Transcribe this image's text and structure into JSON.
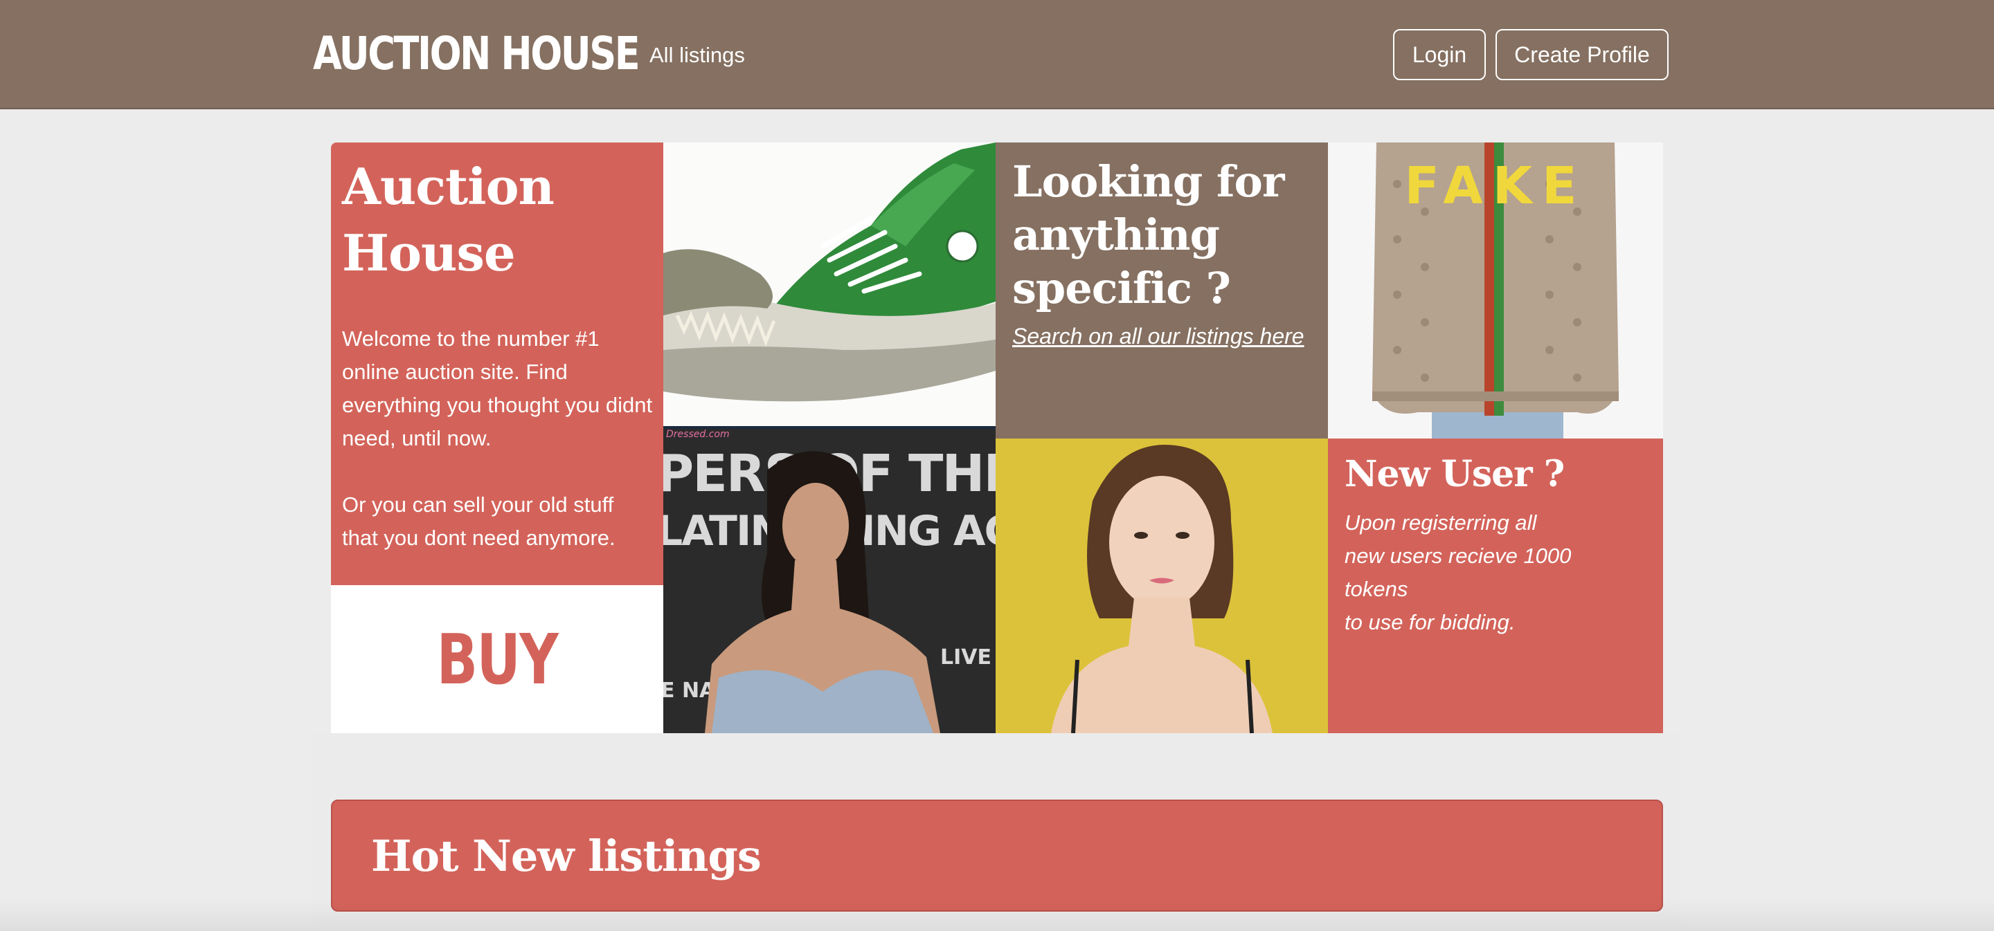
{
  "navbar": {
    "brand": "AUCTION HOUSE",
    "all_listings": "All listings",
    "login": "Login",
    "create_profile": "Create Profile",
    "bg_color": "#857061"
  },
  "hero": {
    "intro": {
      "title": "Auction House",
      "paragraph1": "Welcome to the number #1 online auction site. Find everything you thought you didnt need, until now.",
      "paragraph2": "Or you can sell your old stuff that you dont need anymore."
    },
    "buy": "BUY",
    "search": {
      "title": "Looking for anything specific ?",
      "link": "Search on all our listings here"
    },
    "jacket_print": "FAKE",
    "photo_watermark": "Dressed.com",
    "new_user": {
      "title": "New User ?",
      "line1": "Upon registerring all",
      "line2": "new users recieve 1000",
      "line3": "tokens",
      "line4": "to use for bidding."
    },
    "accent_color": "#d3635a"
  },
  "hot_listings": {
    "title": "Hot New listings"
  }
}
